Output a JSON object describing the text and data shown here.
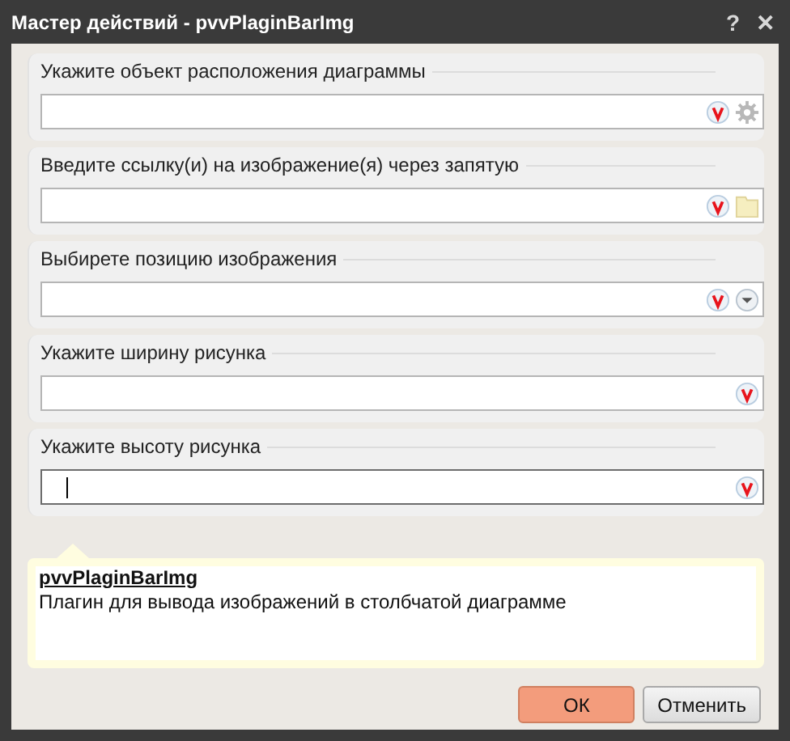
{
  "window": {
    "title": "Мастер действий - pvvPlaginBarImg",
    "buttons": [
      "?",
      "✕"
    ]
  },
  "fields": [
    {
      "label": "Укажите объект расположения диаграммы",
      "kind": "picker",
      "focused": false
    },
    {
      "label": "Введите ссылку(и) на изображение(я) через запятую",
      "kind": "folder",
      "focused": false
    },
    {
      "label": "Выбирете позицию изображения",
      "kind": "dropdown",
      "focused": false
    },
    {
      "label": "Укажите ширину рисунка",
      "kind": "plain",
      "focused": false
    },
    {
      "label": "Укажите высоту рисунка",
      "kind": "plain",
      "focused": true
    }
  ],
  "description": {
    "title": "pvvPlaginBarImg",
    "text": "Плагин для вывода изображений в столбчатой диаграмме"
  },
  "buttons": [
    {
      "label": "ОК",
      "kind": "primary"
    },
    {
      "label": "Отменить",
      "kind": "secondary"
    }
  ]
}
